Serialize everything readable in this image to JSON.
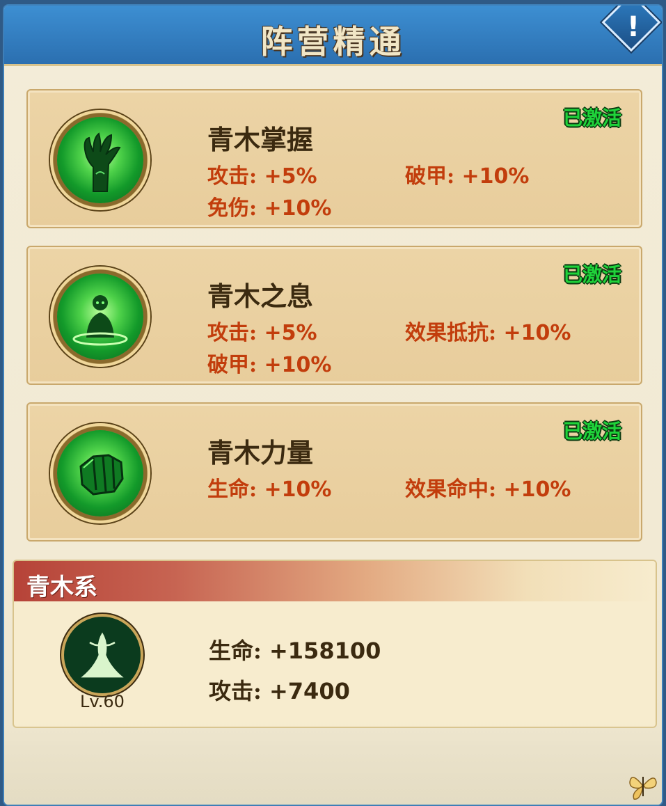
{
  "header": {
    "title": "阵营精通"
  },
  "cards": [
    {
      "name": "青木掌握",
      "status": "已激活",
      "icon": "claw-hand-icon",
      "stats": [
        {
          "label": "攻击:",
          "value": "+5%"
        },
        {
          "label": "破甲:",
          "value": "+10%"
        },
        {
          "label": "免伤:",
          "value": "+10%"
        }
      ]
    },
    {
      "name": "青木之息",
      "status": "已激活",
      "icon": "meditating-monk-icon",
      "stats": [
        {
          "label": "攻击:",
          "value": "+5%"
        },
        {
          "label": "效果抵抗:",
          "value": "+10%"
        },
        {
          "label": "破甲:",
          "value": "+10%"
        }
      ]
    },
    {
      "name": "青木力量",
      "status": "已激活",
      "icon": "fist-icon",
      "stats": [
        {
          "label": "生命:",
          "value": "+10%"
        },
        {
          "label": "效果命中:",
          "value": "+10%"
        }
      ]
    }
  ],
  "faction": {
    "title": "青木系",
    "icon": "tree-icon",
    "level": "Lv.60",
    "stats": [
      {
        "label": "生命:",
        "value": "+158100"
      },
      {
        "label": "攻击:",
        "value": "+7400"
      }
    ]
  },
  "colors": {
    "header_blue": "#2b6fb0",
    "stat_red": "#c23d0c",
    "active_green": "#1fd33a"
  }
}
